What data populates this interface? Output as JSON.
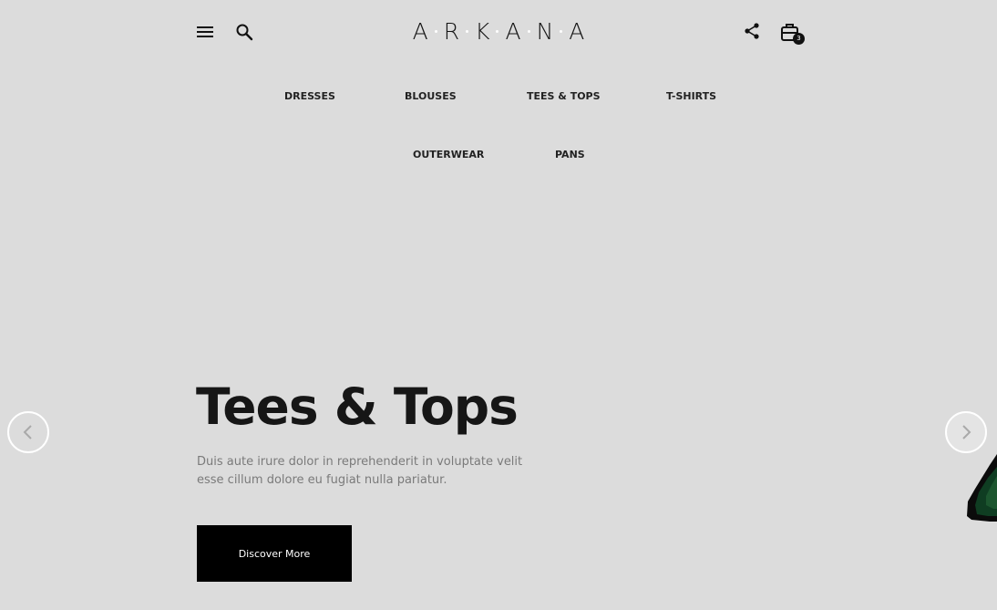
{
  "header": {
    "logo_letters": [
      "A",
      "R",
      "K",
      "A",
      "N",
      "A"
    ],
    "cart_count": "3",
    "icons": {
      "menu": "menu-icon",
      "search": "search-icon",
      "share": "share-icon",
      "cart": "shopping-bag-icon"
    }
  },
  "nav": {
    "items": [
      {
        "label": "DRESSES"
      },
      {
        "label": "BLOUSES"
      },
      {
        "label": "TEES & TOPS"
      },
      {
        "label": "T-SHIRTS"
      },
      {
        "label": "OUTERWEAR"
      },
      {
        "label": "PANS"
      }
    ]
  },
  "hero": {
    "title": "Tees & Tops",
    "description": "Duis aute irure dolor in reprehenderit in voluptate velit esse cillum dolore eu fugiat nulla pariatur.",
    "cta_label": "Discover More",
    "prev_icon": "chevron-left-icon",
    "next_icon": "chevron-right-icon"
  },
  "colors": {
    "background": "#dcdcdc",
    "text": "#151515",
    "muted_text": "#7a7a7a",
    "button_bg": "#000000",
    "button_text": "#ffffff"
  }
}
